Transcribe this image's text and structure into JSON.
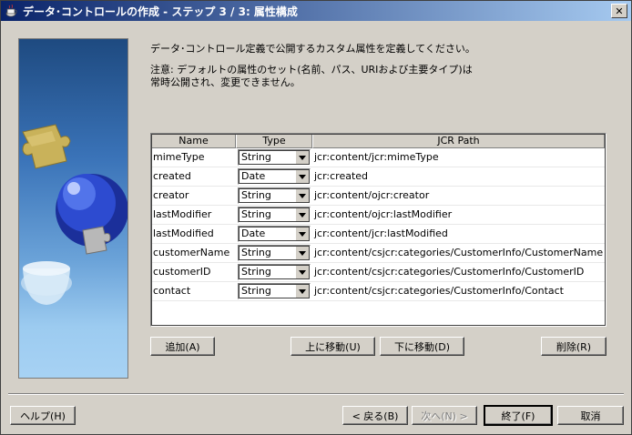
{
  "window": {
    "title": "データ･コントロールの作成 - ステップ 3 / 3: 属性構成",
    "close_glyph": "✕"
  },
  "intro_text": "データ･コントロール定義で公開するカスタム属性を定義してください。",
  "note_text": "注意: デフォルトの属性のセット(名前、パス、URIおよび主要タイプ)は\n常時公開され、変更できません。",
  "table": {
    "headers": {
      "name": "Name",
      "type": "Type",
      "path": "JCR Path"
    },
    "rows": [
      {
        "name": "mimeType",
        "type": "String",
        "path": "jcr:content/jcr:mimeType"
      },
      {
        "name": "created",
        "type": "Date",
        "path": "jcr:created"
      },
      {
        "name": "creator",
        "type": "String",
        "path": "jcr:content/ojcr:creator"
      },
      {
        "name": "lastModifier",
        "type": "String",
        "path": "jcr:content/ojcr:lastModifier"
      },
      {
        "name": "lastModified",
        "type": "Date",
        "path": "jcr:content/jcr:lastModified"
      },
      {
        "name": "customerName",
        "type": "String",
        "path": "jcr:content/csjcr:categories/CustomerInfo/CustomerName"
      },
      {
        "name": "customerID",
        "type": "String",
        "path": "jcr:content/csjcr:categories/CustomerInfo/CustomerID"
      },
      {
        "name": "contact",
        "type": "String",
        "path": "jcr:content/csjcr:categories/CustomerInfo/Contact"
      }
    ]
  },
  "buttons": {
    "add": "追加(A)",
    "move_up": "上に移動(U)",
    "move_down": "下に移動(D)",
    "delete": "削除(R)",
    "help": "ヘルプ(H)",
    "back": "< 戻る(B)",
    "next": "次へ(N) >",
    "finish": "終了(F)",
    "cancel": "取消"
  },
  "icons": {
    "title_icon": "coffee-cup-icon",
    "dropdown": "chevron-down-icon"
  }
}
